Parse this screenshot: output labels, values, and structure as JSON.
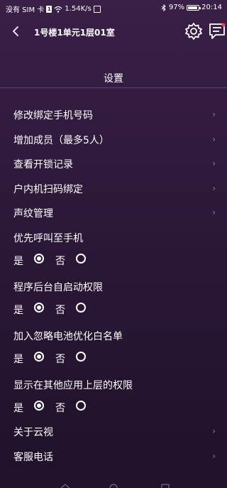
{
  "status": {
    "carrier": "没有 SIM 卡",
    "sim_badge": "1",
    "speed": "1.54K/s",
    "battery_percent": "97%",
    "battery_level": 0.97,
    "time": "20:14"
  },
  "header": {
    "title": "1号楼1单元1层01室"
  },
  "page": {
    "title": "设置"
  },
  "menu": [
    {
      "label": "修改绑定手机号码"
    },
    {
      "label": "增加成员（最多5人）"
    },
    {
      "label": "查看开锁记录"
    },
    {
      "label": "户内机扫码绑定"
    },
    {
      "label": "声纹管理"
    }
  ],
  "toggles": [
    {
      "label": "优先呼叫至手机",
      "yes": "是",
      "no": "否",
      "selected": "yes"
    },
    {
      "label": "程序后台自启动权限",
      "yes": "是",
      "no": "否",
      "selected": "yes"
    },
    {
      "label": "加入忽略电池优化白名单",
      "yes": "是",
      "no": "否",
      "selected": "yes"
    },
    {
      "label": "显示在其他应用上层的权限",
      "yes": "是",
      "no": "否",
      "selected": "yes"
    }
  ],
  "bottom_menu": [
    {
      "label": "关于云视"
    },
    {
      "label": "客服电话"
    }
  ],
  "chevron": "›"
}
